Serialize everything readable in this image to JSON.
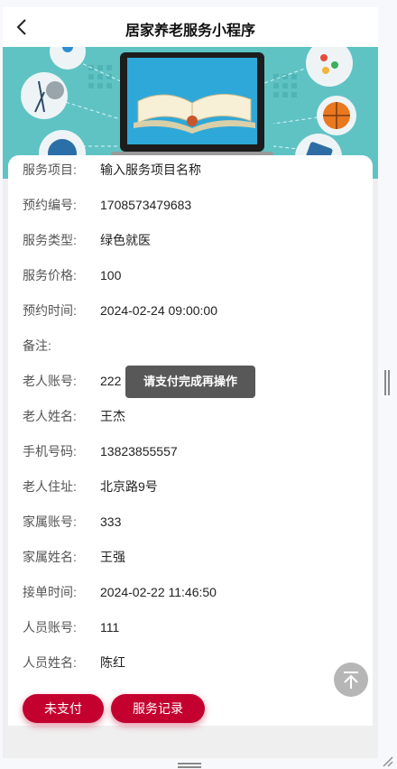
{
  "navbar": {
    "title": "居家养老服务小程序"
  },
  "details": [
    {
      "label": "服务项目:",
      "value": "输入服务项目名称"
    },
    {
      "label": "预约编号:",
      "value": "1708573479683"
    },
    {
      "label": "服务类型:",
      "value": "绿色就医"
    },
    {
      "label": "服务价格:",
      "value": "100"
    },
    {
      "label": "预约时间:",
      "value": "2024-02-24 09:00:00"
    },
    {
      "label": "备注:",
      "value": ""
    },
    {
      "label": "老人账号:",
      "value": "222"
    },
    {
      "label": "老人姓名:",
      "value": "王杰"
    },
    {
      "label": "手机号码:",
      "value": "13823855557"
    },
    {
      "label": "老人住址:",
      "value": "北京路9号"
    },
    {
      "label": "家属账号:",
      "value": "333"
    },
    {
      "label": "家属姓名:",
      "value": "王强"
    },
    {
      "label": "接单时间:",
      "value": "2024-02-22 11:46:50"
    },
    {
      "label": "人员账号:",
      "value": "111"
    },
    {
      "label": "人员姓名:",
      "value": "陈红"
    }
  ],
  "actions": {
    "unpaid_label": "未支付",
    "records_label": "服务记录"
  },
  "toast": {
    "text": "请支付完成再操作"
  },
  "icons": {
    "back": "chevron-left-icon",
    "to_top": "arrow-up-icon"
  },
  "colors": {
    "accent": "#c4002f",
    "banner": "#5fc3c4"
  }
}
